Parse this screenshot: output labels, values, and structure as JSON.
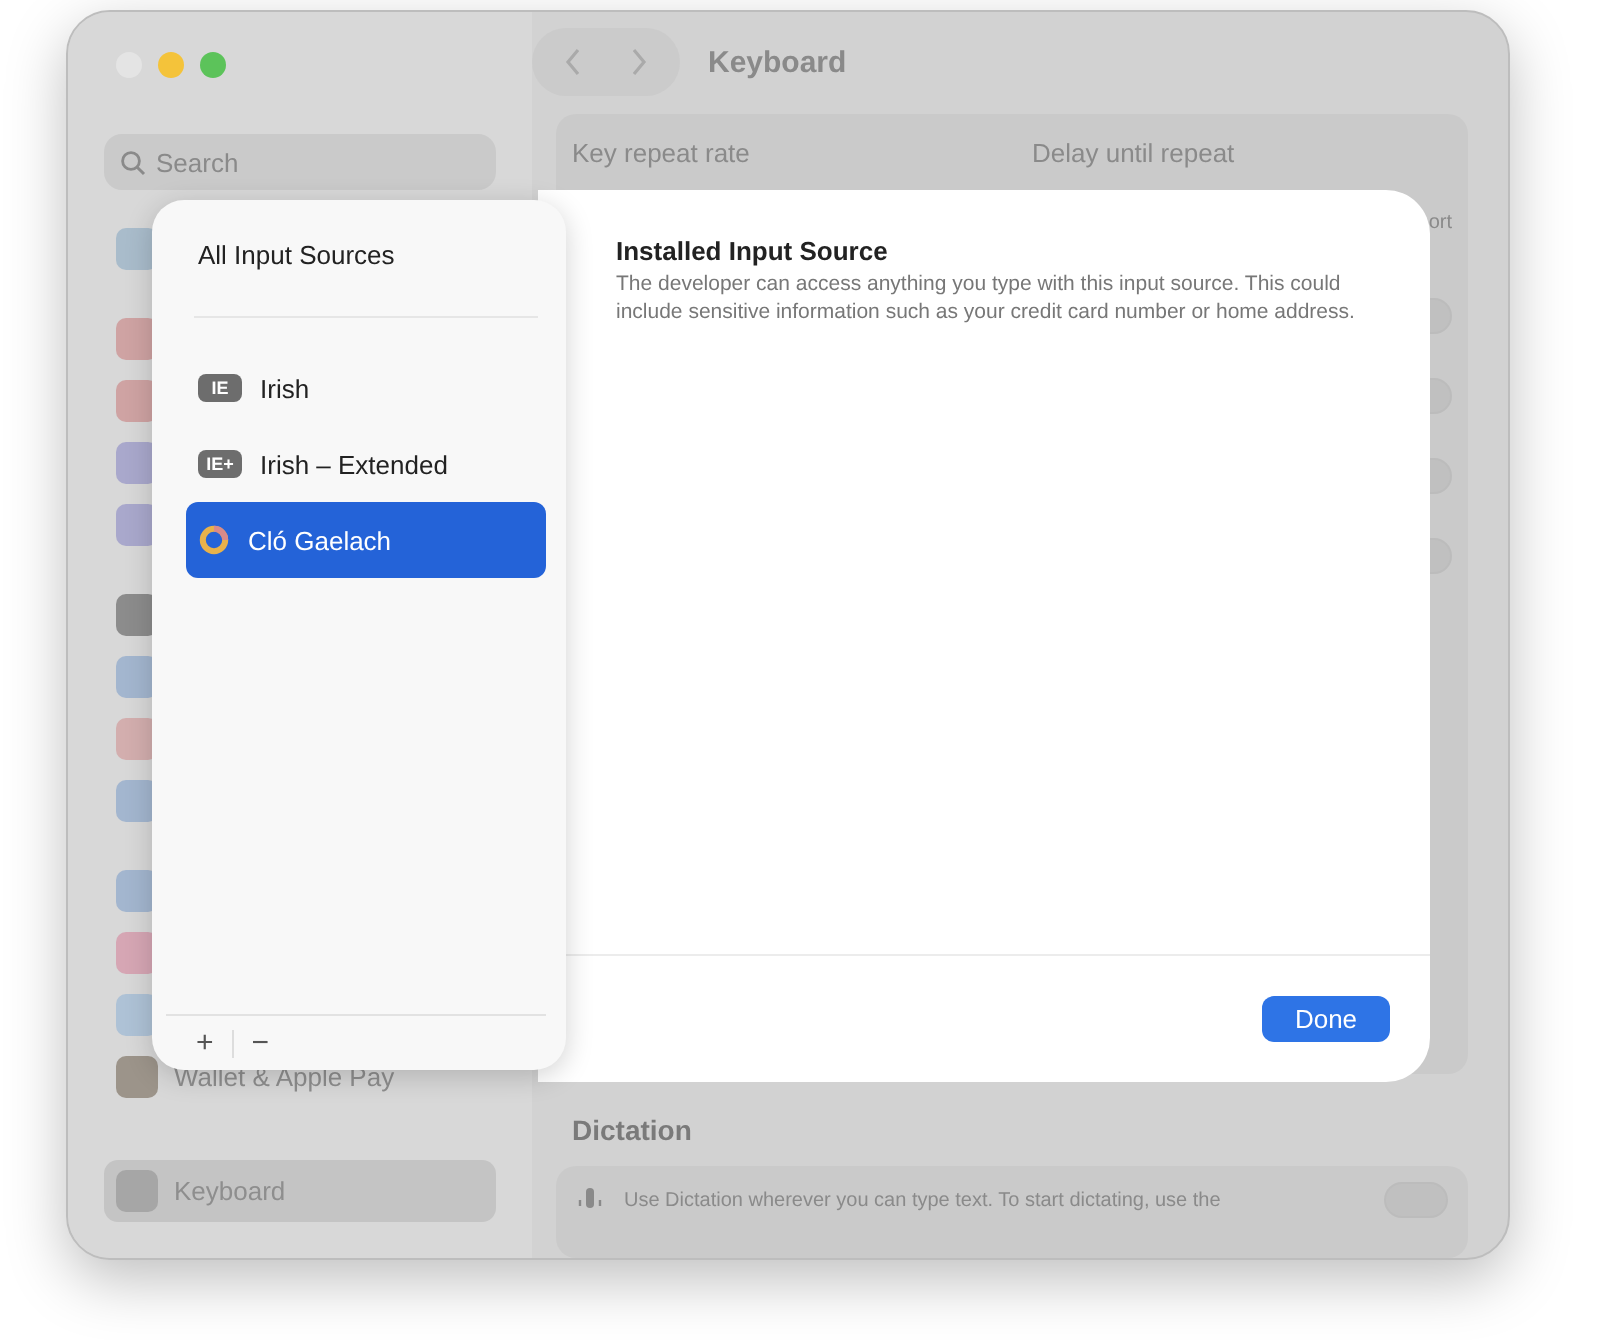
{
  "window": {
    "title": "Keyboard",
    "traffic_lights": [
      {
        "kind": "close",
        "disabled": true
      },
      {
        "kind": "minimize",
        "disabled": false
      },
      {
        "kind": "zoom",
        "disabled": false
      }
    ]
  },
  "sidebar": {
    "search": {
      "placeholder": "Search"
    },
    "groups": [
      [
        {
          "color": "#a9bccb"
        }
      ],
      [
        {
          "color": "#cfa3a3"
        },
        {
          "color": "#cfa3a3"
        },
        {
          "color": "#a9a8cc"
        },
        {
          "color": "#a9a8cc"
        }
      ],
      [
        {
          "color": "#8c8c8c"
        },
        {
          "color": "#a3b6cf"
        },
        {
          "color": "#d3aeae"
        },
        {
          "color": "#a3b6cf"
        }
      ],
      [
        {
          "color": "#a3b6cf"
        },
        {
          "color": "#d6a6b4"
        },
        {
          "color": "#aec2d6"
        },
        {
          "label": "Wallet & Apple Pay",
          "color": "#9c948a",
          "selected": false
        }
      ],
      [
        {
          "label": "Keyboard",
          "color": "#a6a6a6",
          "selected": true
        }
      ]
    ]
  },
  "content": {
    "key_repeat_label": "Key repeat rate",
    "delay_label": "Delay until repeat",
    "cut_label": "ort",
    "toggles": [
      {
        "on": false
      },
      {
        "on": false
      },
      {
        "on": false
      },
      {
        "on": false
      }
    ],
    "dictation": {
      "title": "Dictation",
      "description": "Use Dictation wherever you can type text. To start dictating, use the",
      "on": false
    }
  },
  "sheet": {
    "header": "All Input Sources",
    "sources": [
      {
        "kind": "badge",
        "badge": "IE",
        "label": "Irish",
        "selected": false
      },
      {
        "kind": "badge",
        "badge": "IE+",
        "label": "Irish – Extended",
        "selected": false
      },
      {
        "kind": "ring",
        "label": "Cló Gaelach",
        "selected": true
      }
    ],
    "add": "+",
    "remove": "−",
    "detail_title": "Installed Input Source",
    "detail_text": "The developer can access anything you type with this input source. This could include sensitive information such as your credit card number or home address.",
    "done": "Done"
  }
}
